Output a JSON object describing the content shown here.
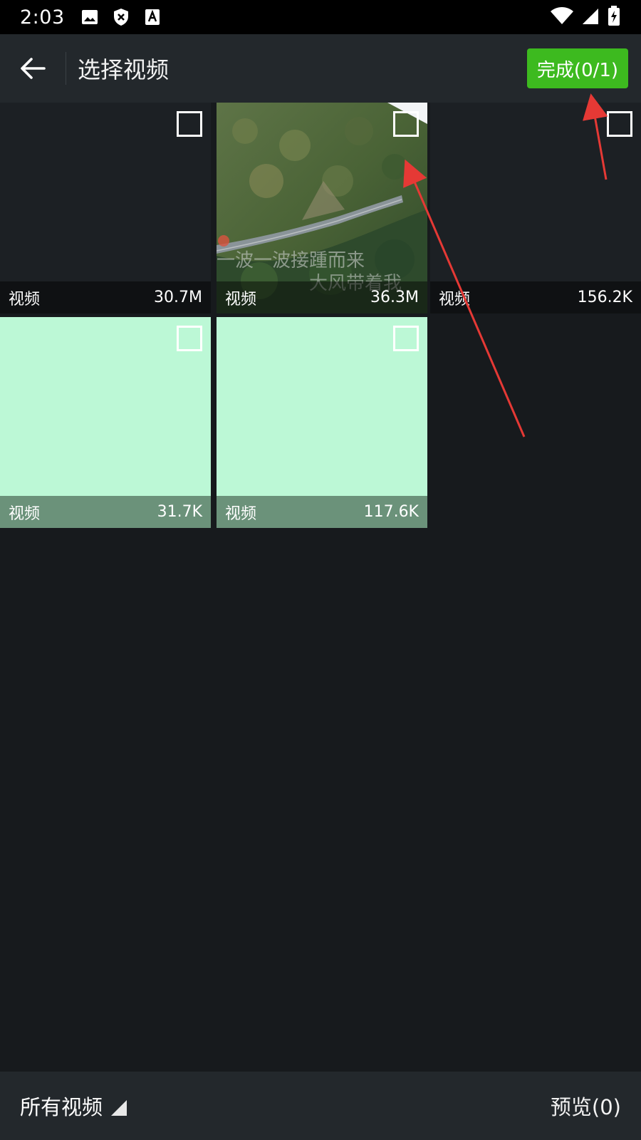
{
  "status_bar": {
    "time": "2:03",
    "icons": [
      "image-icon",
      "shield-x-icon",
      "font-a-icon"
    ],
    "right_icons": [
      "wifi-icon",
      "signal-icon",
      "battery-charging-icon"
    ]
  },
  "header": {
    "title": "选择视频",
    "done_label": "完成(0/1)",
    "accent_color": "#3dba1f"
  },
  "videos": [
    {
      "label": "视频",
      "size": "30.7M",
      "thumb": "dark"
    },
    {
      "label": "视频",
      "size": "36.3M",
      "thumb": "photo",
      "overlay_text": [
        "一波一波接踵而来",
        "大风带着我"
      ]
    },
    {
      "label": "视频",
      "size": "156.2K",
      "thumb": "dark"
    },
    {
      "label": "视频",
      "size": "31.7K",
      "thumb": "mint"
    },
    {
      "label": "视频",
      "size": "117.6K",
      "thumb": "mint"
    }
  ],
  "footer": {
    "album_label": "所有视频",
    "preview_label": "预览(0)"
  }
}
